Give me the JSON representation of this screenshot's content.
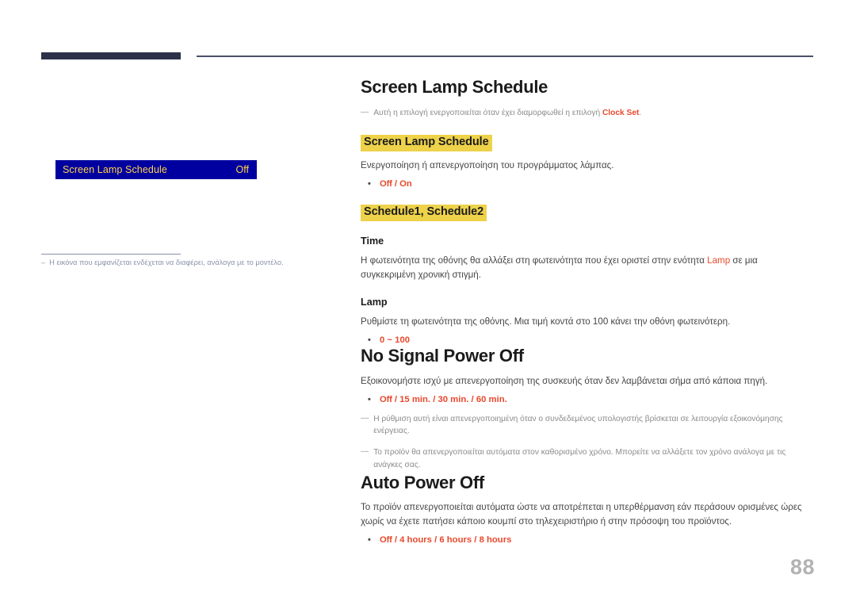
{
  "header": {
    "block_present": true
  },
  "left": {
    "osd": {
      "label": "Screen Lamp Schedule",
      "value": "Off"
    },
    "note": {
      "dash": "–",
      "text": "Η εικόνα που εμφανίζεται ενδέχεται να διαφέρει, ανάλογα με το μοντέλο."
    }
  },
  "sections": {
    "screen_lamp_schedule": {
      "title": "Screen Lamp Schedule",
      "note": {
        "dash": "—",
        "before": "Αυτή η επιλογή ενεργοποιείται όταν έχει διαμορφωθεί η επιλογή ",
        "accent": "Clock Set",
        "after": "."
      },
      "highlight1": "Screen Lamp  Schedule",
      "desc1": "Ενεργοποίηση ή απενεργοποίηση του προγράμματος λάμπας.",
      "options1_first": "Off",
      "options1_rest": "/ On",
      "highlight2": "Schedule1, Schedule2",
      "sub_time": "Time",
      "time_before": "Η φωτεινότητα της οθόνης θα αλλάξει στη φωτεινότητα που έχει οριστεί στην ενότητα ",
      "time_accent": "Lamp",
      "time_after": " σε μια συγκεκριμένη χρονική στιγμή.",
      "sub_lamp": "Lamp",
      "lamp_desc": "Ρυθμίστε τη φωτεινότητα της οθόνης. Μια τιμή κοντά στο 100 κάνει την οθόνη φωτεινότερη.",
      "lamp_range": "0 ~ 100"
    },
    "no_signal_power_off": {
      "title": "No Signal Power Off",
      "desc": "Εξοικονομήστε ισχύ με απενεργοποίηση της συσκευής όταν δεν λαμβάνεται σήμα από κάποια πηγή.",
      "options_first": "Off",
      "options_rest": "/ 15 min. / 30 min. / 60 min.",
      "note1": {
        "dash": "—",
        "text": "Η ρύθμιση αυτή είναι απενεργοποιημένη όταν ο συνδεδεμένος υπολογιστής βρίσκεται σε λειτουργία εξοικονόμησης ενέργειας."
      },
      "note2": {
        "dash": "—",
        "text": "Το προϊόν θα απενεργοποιείται αυτόματα στον καθορισμένο χρόνο. Μπορείτε να αλλάξετε τον χρόνο ανάλογα με τις ανάγκες σας."
      }
    },
    "auto_power_off": {
      "title": "Auto Power Off",
      "desc": "Το προϊόν απενεργοποιείται αυτόματα ώστε να αποτρέπεται η υπερθέρμανση εάν περάσουν ορισμένες ώρες χωρίς να έχετε πατήσει κάποιο κουμπί στο τηλεχειριστήριο ή στην πρόσοψη του προϊόντος.",
      "options_first": "Off",
      "options_rest": "/ 4 hours / 6 hours / 8 hours"
    }
  },
  "bullet_glyph": "•",
  "page_number": "88",
  "colors": {
    "accent_red": "#e8492c",
    "highlight_yellow": "#edd24a",
    "osd_blue": "#0000a0",
    "osd_gold": "#ffd24a",
    "navy": "#2c3149",
    "note_gray": "#8b8b8b",
    "left_note": "#8a94ab",
    "page_no": "#b3b3b3"
  }
}
